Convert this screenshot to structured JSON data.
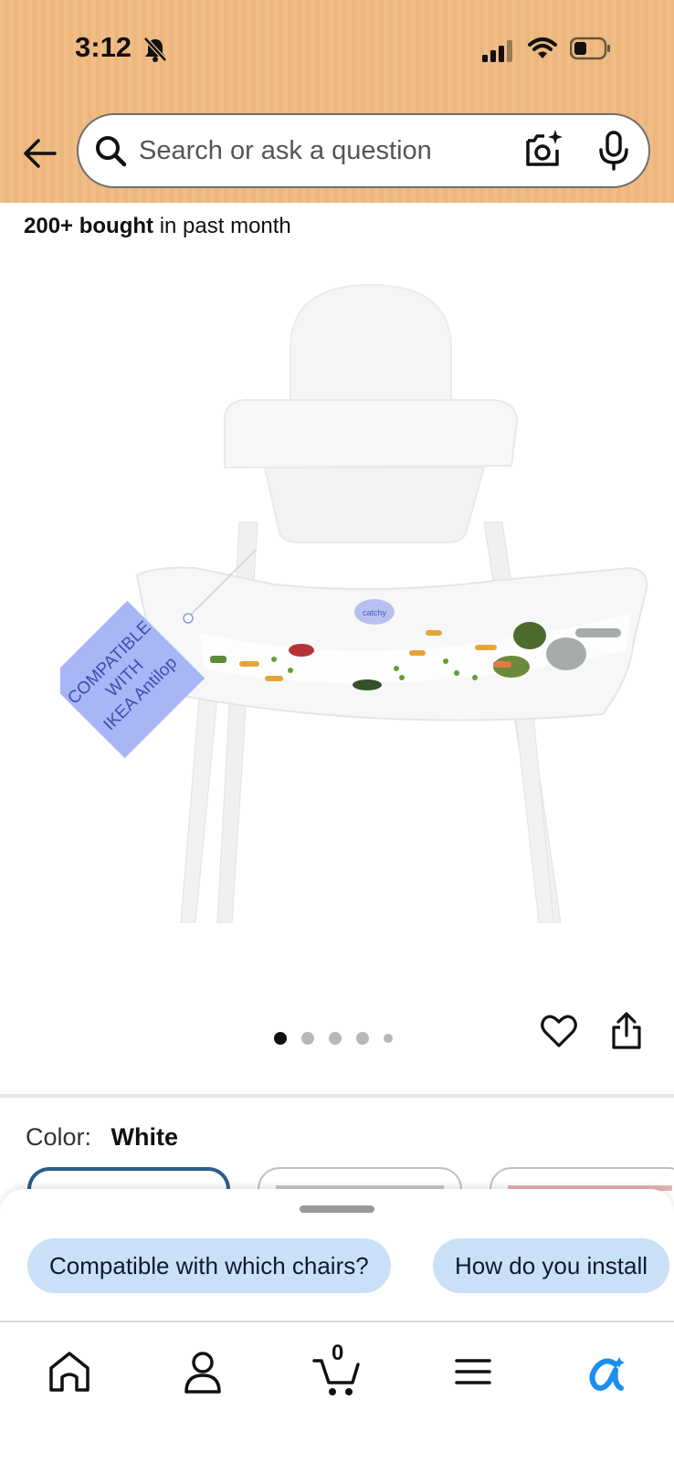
{
  "status_bar": {
    "time": "3:12"
  },
  "search": {
    "placeholder": "Search or ask a question"
  },
  "product": {
    "bought_bold": "200+ bought",
    "bought_rest": " in past month",
    "image_tag_lines": [
      "COMPATIBLE",
      "WITH",
      "IKEA Antilop"
    ],
    "brand_logo_text": "catchy",
    "carousel": {
      "count": 5,
      "active_index": 0
    }
  },
  "color": {
    "label": "Color:",
    "value": "White"
  },
  "suggestions": [
    {
      "label": "Compatible with which chairs?"
    },
    {
      "label": "How do you install"
    }
  ],
  "nav": {
    "cart_count": "0",
    "icons": [
      "home-icon",
      "account-icon",
      "cart-icon",
      "menu-icon",
      "rufus-icon"
    ]
  },
  "colors": {
    "header_bg": "#f0bd85",
    "chip_bg": "#c9e0f8",
    "selected_swatch_border": "#2b5d8a",
    "tag_color": "#a9b6f5",
    "rufus_blue": "#1a8ff0"
  }
}
